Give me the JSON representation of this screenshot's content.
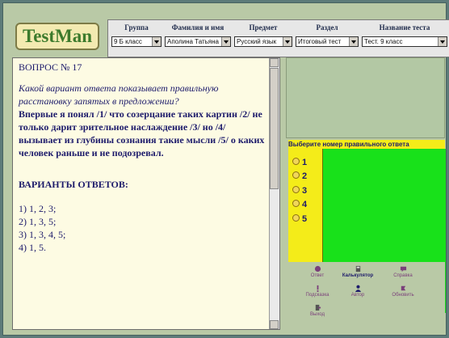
{
  "app": {
    "logo": "TestMan"
  },
  "filters": [
    {
      "label": "Группа",
      "value": "9 Б класс"
    },
    {
      "label": "Фамилия и имя",
      "value": "Аполина Татьяна"
    },
    {
      "label": "Предмет",
      "value": "Русский язык"
    },
    {
      "label": "Раздел",
      "value": "Итоговый тест"
    },
    {
      "label": "Название теста",
      "value": "Тест. 9 класс"
    }
  ],
  "question": {
    "number": "ВОПРОС № 17",
    "prompt": "Какой вариант ответа показывает правильную расстановку запятых в предложении?",
    "body": "Впервые я понял /1/ что созерцание таких картин /2/ не только дарит зрительное наслаждение /3/ но /4/ вызывает из глубины сознания такие мысли /5/ о каких человек раньше и не подозревал.",
    "variants_heading": "ВАРИАНТЫ ОТВЕТОВ:",
    "options": [
      "1) 1, 2, 3;",
      "2) 1, 3, 5;",
      "3) 1, 3, 4, 5;",
      "4) 1, 5."
    ]
  },
  "answer": {
    "title": "Выберите номер правильного ответа",
    "choices": [
      "1",
      "2",
      "3",
      "4",
      "5"
    ]
  },
  "tools": [
    {
      "label": "Ответ",
      "icon": "answer-icon"
    },
    {
      "label": "Калькулятор",
      "icon": "calculator-icon"
    },
    {
      "label": "Справка",
      "icon": "help-icon"
    },
    {
      "label": "Подсказка",
      "icon": "hint-icon"
    },
    {
      "label": "Автор",
      "icon": "author-icon"
    },
    {
      "label": "Обновить",
      "icon": "refresh-icon"
    },
    {
      "label": "Выход",
      "icon": "exit-icon"
    }
  ],
  "colors": {
    "answer_panel": "#f4ec19",
    "answer_area": "#18e11a",
    "frame": "#b9c9a6"
  }
}
